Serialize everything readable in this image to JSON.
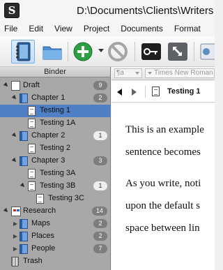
{
  "window": {
    "title": "D:\\Documents\\Clients\\Writers"
  },
  "menu": [
    "File",
    "Edit",
    "View",
    "Project",
    "Documents",
    "Format"
  ],
  "toolbar": {
    "buttons": [
      {
        "name": "binder",
        "icon": "binder-notebook-icon",
        "selected": true
      },
      {
        "name": "collections",
        "icon": "folder-icon"
      },
      {
        "name": "add",
        "icon": "plus-circle-icon",
        "has_dropdown": true
      },
      {
        "name": "delete",
        "icon": "prohibited-icon"
      },
      {
        "name": "key",
        "icon": "key-icon"
      },
      {
        "name": "composition",
        "icon": "fullscreen-arrows-icon"
      },
      {
        "name": "edit",
        "icon": "edit-icon"
      }
    ]
  },
  "binder": {
    "header": "Binder",
    "items": [
      {
        "label": "Draft",
        "type": "draft",
        "level": 0,
        "disclosure": "open",
        "badge": "9",
        "badge_style": "dark"
      },
      {
        "label": "Chapter 1",
        "type": "folder",
        "level": 1,
        "disclosure": "open",
        "badge": "2",
        "badge_style": "dark"
      },
      {
        "label": "Testing 1",
        "type": "doc",
        "level": 2,
        "selected": true
      },
      {
        "label": "Testing 1A",
        "type": "doc",
        "level": 2
      },
      {
        "label": "Chapter 2",
        "type": "folder",
        "level": 1,
        "disclosure": "open",
        "badge": "1",
        "badge_style": "light"
      },
      {
        "label": "Testing 2",
        "type": "doc",
        "level": 2
      },
      {
        "label": "Chapter 3",
        "type": "folder",
        "level": 1,
        "disclosure": "open",
        "badge": "3",
        "badge_style": "dark"
      },
      {
        "label": "Testing 3A",
        "type": "doc",
        "level": 2
      },
      {
        "label": "Testing 3B",
        "type": "doc",
        "level": 2,
        "disclosure": "open",
        "badge": "1",
        "badge_style": "light"
      },
      {
        "label": "Testing 3C",
        "type": "doc",
        "level": 3
      },
      {
        "label": "Research",
        "type": "research",
        "level": 0,
        "disclosure": "open",
        "badge": "14",
        "badge_style": "dark"
      },
      {
        "label": "Maps",
        "type": "folder",
        "level": 1,
        "disclosure": "closed",
        "badge": "2",
        "badge_style": "dark"
      },
      {
        "label": "Places",
        "type": "folder",
        "level": 1,
        "disclosure": "closed",
        "badge": "2",
        "badge_style": "dark"
      },
      {
        "label": "People",
        "type": "folder",
        "level": 1,
        "disclosure": "closed",
        "badge": "7",
        "badge_style": "dark"
      },
      {
        "label": "Trash",
        "type": "trash",
        "level": 0
      }
    ]
  },
  "format_bar": {
    "paragraph_style": "¶a",
    "font": "Times New Roman"
  },
  "header_bar": {
    "doc_title": "Testing 1"
  },
  "editor": {
    "lines": [
      "This is an example",
      "sentence becomes",
      "As you write, noti",
      "upon the default s",
      "space between lin"
    ]
  },
  "colors": {
    "selected_row": "#4f7fc4",
    "binder_bg": "#a8a8a8",
    "toolbar_selected": "#c4ddf6"
  }
}
